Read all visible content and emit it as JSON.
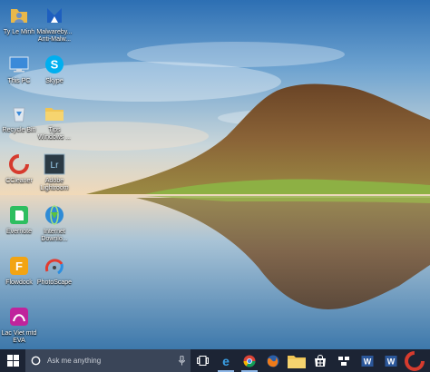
{
  "desktop": {
    "icons": [
      {
        "label": "Ty Le Minh",
        "icon": "user-folder-icon"
      },
      {
        "label": "Malwareby...\nAnti-Malw...",
        "icon": "malwarebytes-icon"
      },
      {
        "label": "This PC",
        "icon": "computer-icon"
      },
      {
        "label": "Skype",
        "icon": "skype-icon"
      },
      {
        "label": "Recycle Bin",
        "icon": "recycle-bin-icon"
      },
      {
        "label": "Tips\nWindows ...",
        "icon": "folder-icon"
      },
      {
        "label": "CCleaner",
        "icon": "ccleaner-icon"
      },
      {
        "label": "Adobe\nLightroom",
        "icon": "lightroom-icon"
      },
      {
        "label": "Evernote",
        "icon": "evernote-icon"
      },
      {
        "label": "Internet\nDownlo...",
        "icon": "internet-download-manager-icon"
      },
      {
        "label": "Flowdock",
        "icon": "flowdock-icon"
      },
      {
        "label": "PhotoScape",
        "icon": "photoscape-icon"
      },
      {
        "label": "Lac Viet mtd\nEVA",
        "icon": "lac-viet-icon"
      }
    ]
  },
  "taskbar": {
    "search_placeholder": "Ask me anything",
    "pinned": [
      {
        "name": "task-view",
        "icon": "task-view-icon"
      },
      {
        "name": "edge",
        "icon": "edge-icon"
      },
      {
        "name": "chrome",
        "icon": "chrome-icon"
      },
      {
        "name": "firefox",
        "icon": "firefox-icon"
      },
      {
        "name": "file-explorer",
        "icon": "folder-icon"
      },
      {
        "name": "store",
        "icon": "store-icon"
      },
      {
        "name": "apps",
        "icon": "apps-icon"
      },
      {
        "name": "word",
        "icon": "word-icon"
      },
      {
        "name": "word-2",
        "icon": "word-icon"
      },
      {
        "name": "ccleaner",
        "icon": "ccleaner-icon"
      }
    ]
  },
  "colors": {
    "taskbar": "#1c2434",
    "search_box": "#3a4558",
    "accent": "#8fb8e8"
  }
}
